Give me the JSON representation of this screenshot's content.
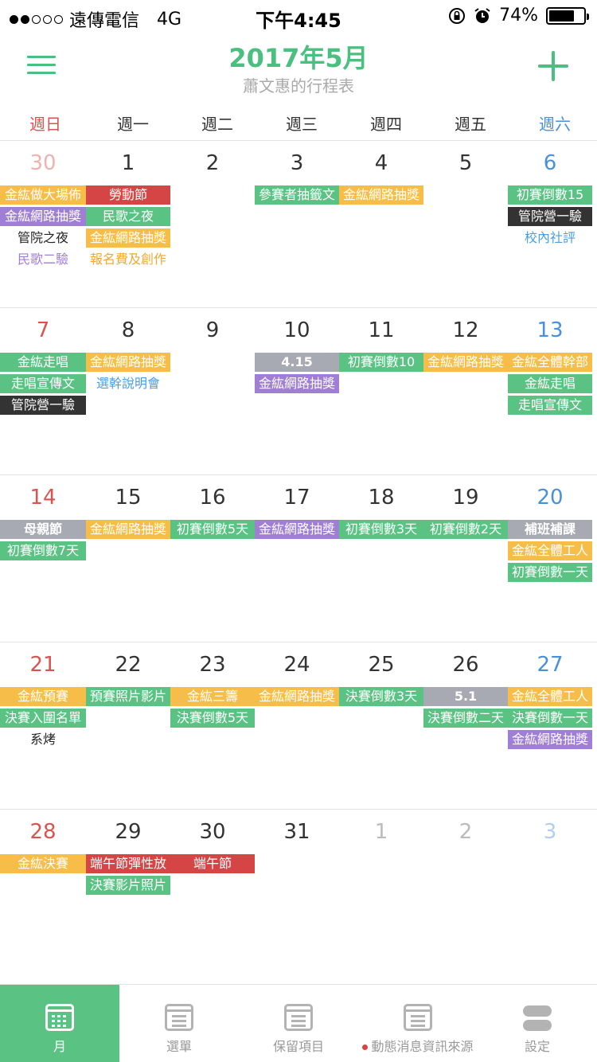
{
  "status_bar": {
    "carrier": "遠傳電信",
    "network": "4G",
    "time": "下午4:45",
    "battery": "74%",
    "battery_level": 0.74
  },
  "header": {
    "title": "2017年5月",
    "subtitle": "蕭文惠的行程表"
  },
  "weekdays": [
    "週日",
    "週一",
    "週二",
    "週三",
    "週四",
    "週五",
    "週六"
  ],
  "weeks": [
    [
      {
        "n": "30",
        "other": true,
        "events": [
          [
            "金紘做大場佈",
            "orange"
          ],
          [
            "金紘網路抽獎",
            "purple"
          ],
          [
            "管院之夜",
            "t-black"
          ],
          [
            "民歌二驗",
            "t-purple"
          ]
        ]
      },
      {
        "n": "1",
        "events": [
          [
            "勞動節",
            "red"
          ],
          [
            "民歌之夜",
            "green"
          ],
          [
            "金紘網路抽獎",
            "orange"
          ],
          [
            "報名費及創作",
            "t-orange"
          ]
        ]
      },
      {
        "n": "2",
        "events": []
      },
      {
        "n": "3",
        "events": [
          [
            "參賽者抽籤文",
            "green"
          ]
        ]
      },
      {
        "n": "4",
        "events": [
          [
            "金紘網路抽獎",
            "orange"
          ]
        ]
      },
      {
        "n": "5",
        "events": []
      },
      {
        "n": "6",
        "events": [
          [
            "初賽倒數15",
            "green"
          ],
          [
            "管院營一驗",
            "dark"
          ],
          [
            "校內社評",
            "t-blue"
          ]
        ]
      }
    ],
    [
      {
        "n": "7",
        "events": [
          [
            "金紘走唱",
            "green"
          ],
          [
            "走唱宣傳文",
            "green"
          ],
          [
            "管院營一驗",
            "dark"
          ]
        ]
      },
      {
        "n": "8",
        "events": [
          [
            "金紘網路抽獎",
            "orange"
          ],
          [
            "選幹說明會",
            "t-blue"
          ]
        ]
      },
      {
        "n": "9",
        "events": []
      },
      {
        "n": "10",
        "events": [
          [
            "4.15",
            "gray"
          ],
          [
            "金紘網路抽獎",
            "purple"
          ]
        ]
      },
      {
        "n": "11",
        "events": [
          [
            "初賽倒數10",
            "green"
          ]
        ]
      },
      {
        "n": "12",
        "events": [
          [
            "金紘網路抽獎",
            "orange"
          ]
        ]
      },
      {
        "n": "13",
        "events": [
          [
            "金紘全體幹部",
            "orange"
          ],
          [
            "金紘走唱",
            "green"
          ],
          [
            "走唱宣傳文",
            "green"
          ]
        ]
      }
    ],
    [
      {
        "n": "14",
        "events": [
          [
            "母親節",
            "gray"
          ],
          [
            "初賽倒數7天",
            "green"
          ]
        ]
      },
      {
        "n": "15",
        "events": [
          [
            "金紘網路抽獎",
            "orange"
          ]
        ]
      },
      {
        "n": "16",
        "events": [
          [
            "初賽倒數5天",
            "green"
          ]
        ]
      },
      {
        "n": "17",
        "events": [
          [
            "金紘網路抽獎",
            "purple"
          ]
        ]
      },
      {
        "n": "18",
        "events": [
          [
            "初賽倒數3天",
            "green"
          ]
        ]
      },
      {
        "n": "19",
        "events": [
          [
            "初賽倒數2天",
            "green"
          ]
        ]
      },
      {
        "n": "20",
        "events": [
          [
            "補班補課",
            "gray"
          ],
          [
            "金紘全體工人",
            "orange"
          ],
          [
            "初賽倒數一天",
            "green"
          ]
        ]
      }
    ],
    [
      {
        "n": "21",
        "events": [
          [
            "金紘預賽",
            "orange"
          ],
          [
            "決賽入圍名單",
            "green"
          ],
          [
            "系烤",
            "t-black"
          ]
        ]
      },
      {
        "n": "22",
        "events": [
          [
            "預賽照片影片",
            "green"
          ]
        ]
      },
      {
        "n": "23",
        "events": [
          [
            "金紘三籌",
            "orange"
          ],
          [
            "決賽倒數5天",
            "green"
          ]
        ]
      },
      {
        "n": "24",
        "events": [
          [
            "金紘網路抽獎",
            "orange"
          ]
        ]
      },
      {
        "n": "25",
        "events": [
          [
            "決賽倒數3天",
            "green"
          ]
        ]
      },
      {
        "n": "26",
        "events": [
          [
            "5.1",
            "gray"
          ],
          [
            "決賽倒數二天",
            "green"
          ]
        ]
      },
      {
        "n": "27",
        "events": [
          [
            "金紘全體工人",
            "orange"
          ],
          [
            "決賽倒數一天",
            "green"
          ],
          [
            "金紘網路抽獎",
            "purple"
          ]
        ]
      }
    ],
    [
      {
        "n": "28",
        "events": [
          [
            "金紘決賽",
            "orange"
          ]
        ]
      },
      {
        "n": "29",
        "events": [
          [
            "端午節彈性放",
            "red"
          ],
          [
            "決賽影片照片",
            "green"
          ]
        ]
      },
      {
        "n": "30",
        "events": [
          [
            "端午節",
            "red"
          ]
        ]
      },
      {
        "n": "31",
        "events": []
      },
      {
        "n": "1",
        "other": true,
        "events": []
      },
      {
        "n": "2",
        "other": true,
        "events": []
      },
      {
        "n": "3",
        "other": true,
        "events": []
      }
    ]
  ],
  "tabs": [
    {
      "label": "月",
      "icon": "calendar-grid-icon",
      "active": true
    },
    {
      "label": "選單",
      "icon": "list-icon",
      "active": false
    },
    {
      "label": "保留項目",
      "icon": "download-box-icon",
      "active": false
    },
    {
      "label": "動態消息資訊來源",
      "icon": "news-feed-icon",
      "active": false,
      "dot": true
    },
    {
      "label": "設定",
      "icon": "toggle-settings-icon",
      "active": false
    }
  ]
}
